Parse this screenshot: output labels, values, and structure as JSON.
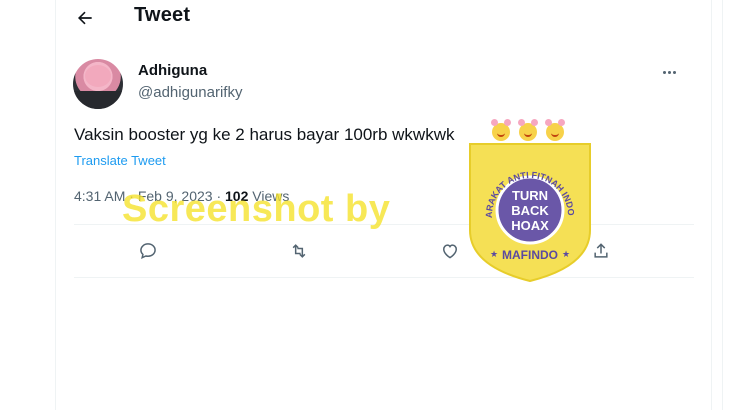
{
  "header": {
    "title": "Tweet"
  },
  "tweet": {
    "author_name": "Adhiguna",
    "author_handle": "@adhigunarifky",
    "text": "Vaksin booster yg ke 2 harus bayar 100rb wkwkwk",
    "translate_label": "Translate Tweet",
    "time": "4:31 AM",
    "date": "Feb 9, 2023",
    "views_count": "102",
    "views_label": "Views"
  },
  "watermark": {
    "text": "Screenshot by",
    "badge_top_text": "MASYARAKAT ANTI FITNAH INDONESIA",
    "badge_center_line1": "TURN",
    "badge_center_line2": "BACK",
    "badge_center_line3": "HOAX",
    "badge_bottom_text": "MAFINDO"
  },
  "colors": {
    "link": "#1d9bf0",
    "muted": "#536471",
    "badge_yellow": "#f5e055",
    "badge_purple": "#6a57a8"
  },
  "icons": [
    "back-arrow-icon",
    "more-icon",
    "reply-icon",
    "retweet-icon",
    "like-icon",
    "share-icon"
  ]
}
